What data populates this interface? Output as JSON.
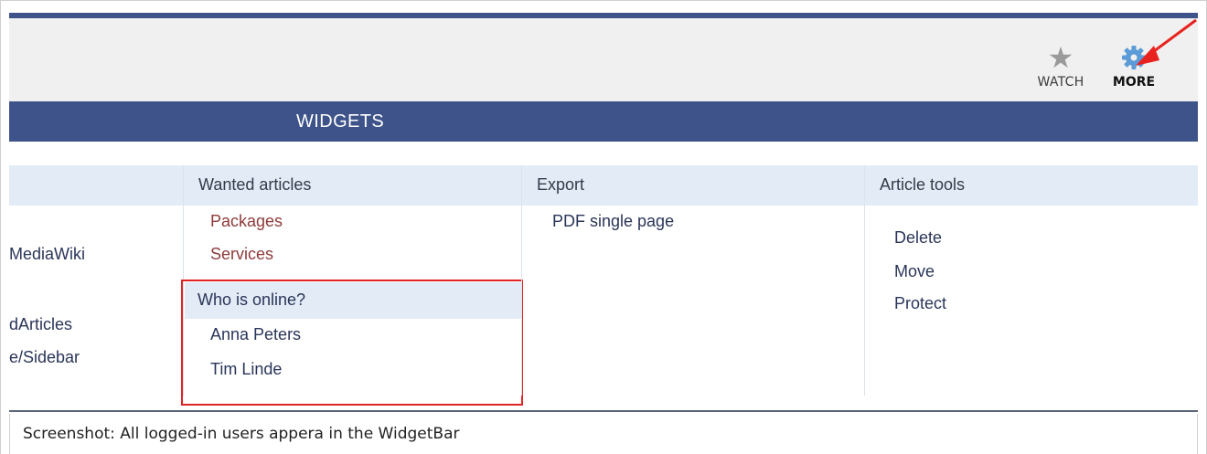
{
  "toolbar": {
    "watch_label": "WATCH",
    "more_label": "MORE",
    "watch_icon": "star-icon",
    "more_icon": "gear-icon"
  },
  "banner": {
    "title": "WIDGETS"
  },
  "columns": {
    "left_partial": {
      "items": [
        "MediaWiki",
        "dArticles",
        "e/Sidebar"
      ]
    },
    "wanted": {
      "header": "Wanted articles",
      "items": [
        "Packages",
        "Services"
      ]
    },
    "online": {
      "header": "Who is online?",
      "users": [
        "Anna Peters",
        "Tim Linde"
      ]
    },
    "export": {
      "header": "Export",
      "items": [
        "PDF single page"
      ]
    },
    "tools": {
      "header": "Article tools",
      "items": [
        "Delete",
        "Move",
        "Protect"
      ]
    }
  },
  "caption": "Screenshot: All logged-in users appera in the WidgetBar",
  "colors": {
    "brand_blue": "#3e5389",
    "header_bg": "#e2ebf6",
    "highlight_red": "#e02424",
    "link_red": "#8f3b3b",
    "gear_blue": "#4a90d9"
  }
}
